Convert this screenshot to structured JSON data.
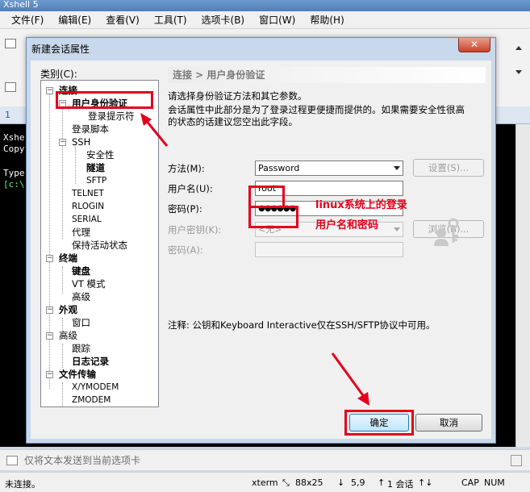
{
  "app": {
    "title": "Xshell 5",
    "menu": [
      "文件(F)",
      "编辑(E)",
      "查看(V)",
      "工具(T)",
      "选项卡(B)",
      "窗口(W)",
      "帮助(H)"
    ],
    "tab_label": "1",
    "terminal_lines": [
      "Xshe",
      "Copy",
      "Type",
      "[c:\\"
    ],
    "send_placeholder": "仅将文本发送到当前选项卡",
    "status": {
      "left": "未连接。",
      "term": "xterm",
      "size": "88x25",
      "pos": "5,9",
      "sessions": "1 会话",
      "caps": "CAP",
      "num": "NUM"
    }
  },
  "dialog": {
    "title": "新建会话属性",
    "close_label": "✕",
    "category_label": "类别(C):",
    "tree": [
      {
        "label": "连接",
        "bold": true
      },
      {
        "label": "用户身份验证",
        "bold": true
      },
      {
        "label": "登录提示符",
        "bold": false
      },
      {
        "label": "登录脚本",
        "bold": false
      },
      {
        "label": "SSH",
        "bold": false
      },
      {
        "label": "安全性",
        "bold": false
      },
      {
        "label": "隧道",
        "bold": true
      },
      {
        "label": "SFTP",
        "bold": false
      },
      {
        "label": "TELNET",
        "bold": false
      },
      {
        "label": "RLOGIN",
        "bold": false
      },
      {
        "label": "SERIAL",
        "bold": false
      },
      {
        "label": "代理",
        "bold": false
      },
      {
        "label": "保持活动状态",
        "bold": false
      },
      {
        "label": "终端",
        "bold": true
      },
      {
        "label": "键盘",
        "bold": true
      },
      {
        "label": "VT 模式",
        "bold": false
      },
      {
        "label": "高级",
        "bold": false
      },
      {
        "label": "外观",
        "bold": true
      },
      {
        "label": "窗口",
        "bold": false
      },
      {
        "label": "高级",
        "bold": false
      },
      {
        "label": "跟踪",
        "bold": false
      },
      {
        "label": "日志记录",
        "bold": true
      },
      {
        "label": "文件传输",
        "bold": true
      },
      {
        "label": "X/YMODEM",
        "bold": false
      },
      {
        "label": "ZMODEM",
        "bold": false
      }
    ],
    "section_title": "连接 > 用户身份验证",
    "desc1": "请选择身份验证方法和其它参数。",
    "desc2": "会话属性中此部分是为了登录过程更便捷而提供的。如果需要安全性很高",
    "desc3": "的状态的话建议您空出此字段。",
    "method_label": "方法(M):",
    "method_value": "Password",
    "settings_button": "设置(S)...",
    "username_label": "用户名(U):",
    "username_value": "root",
    "password_label": "密码(P):",
    "password_value": "●●●●●●",
    "userkey_label": "用户密钥(K):",
    "userkey_value": "<无>",
    "browse_button": "浏览(B)...",
    "passphrase_label": "密码(A):",
    "note": "注释: 公钥和Keyboard Interactive仅在SSH/SFTP协议中可用。",
    "ok_button": "确定",
    "cancel_button": "取消"
  },
  "annotations": {
    "line1": "linux系统上的登录",
    "line2": "用户名和密码",
    "color": "#e3001b"
  }
}
